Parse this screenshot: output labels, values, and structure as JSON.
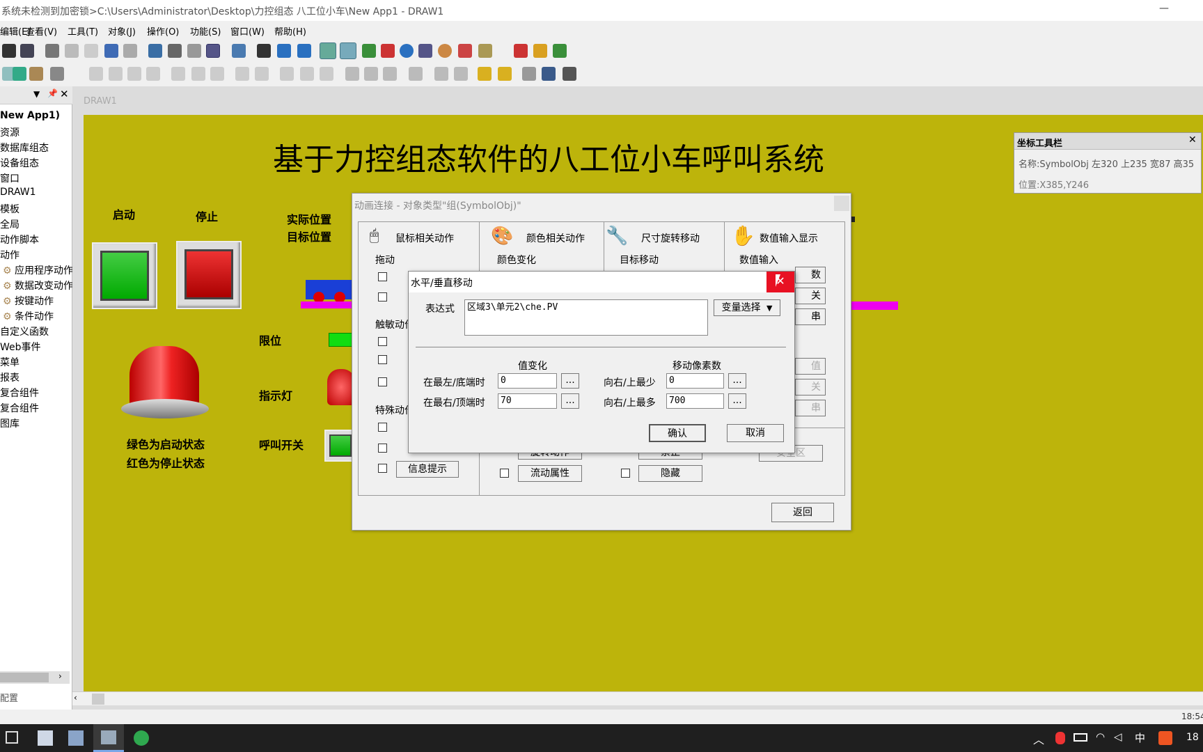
{
  "window": {
    "title": "系统未检测到加密锁>C:\\Users\\Administrator\\Desktop\\力控组态  八工位小车\\New App1 - DRAW1",
    "minimize": "—"
  },
  "menu": [
    "编辑(E)",
    "查看(V)",
    "工具(T)",
    "对象(J)",
    "操作(O)",
    "功能(S)",
    "窗口(W)",
    "帮助(H)"
  ],
  "left_panel": {
    "tree": [
      "New App1)",
      "资源",
      "数据库组态",
      "设备组态",
      "窗口",
      "DRAW1",
      "模板",
      "全局",
      "动作脚本",
      "动作",
      "应用程序动作",
      "数据改变动作",
      "按键动作",
      "条件动作",
      "自定义函数",
      "Web事件",
      "菜单",
      "报表",
      "复合组件",
      "复合组件",
      "图库"
    ],
    "footer": "配置"
  },
  "doc_tab": "DRAW1",
  "canvas": {
    "title": "基于力控组态软件的八工位小车呼叫系统",
    "start_label": "启动",
    "stop_label": "停止",
    "actual_pos": "实际位置",
    "target_pos": "目标位置",
    "limit_label": "限位",
    "indicator_label": "指示灯",
    "call_switch_label": "呼叫开关",
    "green_state": "绿色为启动状态",
    "red_state": "红色为停止状态"
  },
  "coord_toolbar": {
    "title": "坐标工具栏",
    "name_line": "名称:SymbolObj  左320 上235 宽87 高35",
    "pos_line": "位置:X385,Y246"
  },
  "anim_dialog": {
    "title": "动画连接 - 对象类型\"组(SymbolObj)\"",
    "sections": [
      "鼠标相关动作",
      "颜色相关动作",
      "尺寸旋转移动",
      "数值输入显示"
    ],
    "drag": "拖动",
    "touch": "触敏动作",
    "special": "特殊动作",
    "color_change": "颜色变化",
    "target_move": "目标移动",
    "value_input": "数值输入",
    "info_tip": "信息提示",
    "flow_attr": "流动属性",
    "hide": "隐藏",
    "return_btn": "返回",
    "partial": [
      "数",
      "关",
      "串",
      "值",
      "关",
      "串"
    ],
    "partial_rot": "旋转动作",
    "partial_stop": "禁止",
    "partial_sec": "安全区"
  },
  "move_dialog": {
    "title": "水平/垂直移动",
    "expr_label": "表达式",
    "expr_value": "区域3\\单元2\\che.PV",
    "var_select": "变量选择",
    "value_change": "值变化",
    "move_pixels": "移动像素数",
    "left_bottom": "在最左/底端时",
    "right_top": "在最右/顶端时",
    "left_val": "0",
    "right_val": "70",
    "min_label": "向右/上最少",
    "max_label": "向右/上最多",
    "min_val": "0",
    "max_val": "700",
    "ellipsis": "...",
    "ok": "确认",
    "cancel": "取消"
  },
  "taskbar": {
    "ime": "中",
    "time1": "18:54",
    "time2": "18"
  }
}
